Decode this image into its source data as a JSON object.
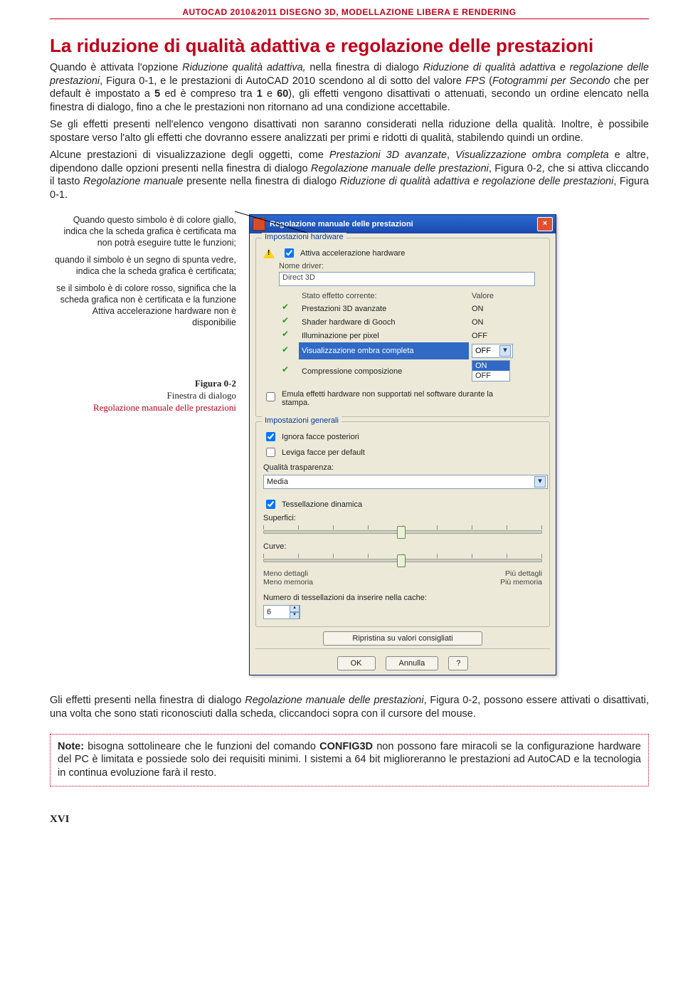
{
  "header": "AUTOCAD 2010&2011 DISEGNO 3D, MODELLAZIONE LIBERA E RENDERING",
  "h1": "La riduzione di qualità adattiva e regolazione delle prestazioni",
  "p1a": "Quando è attivata l'opzione ",
  "p1b": "Riduzione qualità adattiva,",
  "p1c": " nella finestra di dialogo ",
  "p1d": "Riduzione di qualità adattiva e regolazione delle prestazioni",
  "p1e": ", Figura 0-1, e le prestazioni di AutoCAD 2010 scendono al di sotto del valore ",
  "p1f": "FPS",
  "p1g": " (",
  "p1h": "Fotogrammi per Secondo",
  "p1i": " che per default è impostato a ",
  "p1j": "5",
  "p1k": " ed è compreso tra ",
  "p1l": "1",
  "p1m": " e ",
  "p1n": "60",
  "p1o": "), gli effetti vengono disattivati o attenuati, secondo un ordine elencato nella finestra di dialogo, fino a che le prestazioni non ritornano ad una condizione accettabile.",
  "p2": "Se gli effetti presenti nell'elenco vengono disattivati non saranno considerati nella riduzione della qualità. Inoltre, è possibile spostare verso l'alto gli effetti che dovranno essere analizzati per primi e ridotti di qualità, stabilendo quindi un ordine.",
  "p3a": "Alcune prestazioni di visualizzazione degli oggetti, come ",
  "p3b": "Prestazioni 3D avanzate",
  "p3c": ", ",
  "p3d": "Visualizzazione ombra completa",
  "p3e": " e altre, dipendono dalle opzioni presenti nella finestra di dialogo ",
  "p3f": "Regolazione manuale delle prestazioni",
  "p3g": ", Figura 0-2, che si attiva cliccando il tasto ",
  "p3h": "Regolazione manuale",
  "p3i": " presente nella finestra di dialogo ",
  "p3j": "Riduzione di qualità adattiva e regolazione delle prestazioni",
  "p3k": ", Figura 0-1.",
  "side1": "Quando questo simbolo è di colore giallo, indica che la scheda grafica è certificata ma non potrà eseguire tutte le funzioni;",
  "side2": "quando il simbolo è un segno di spunta vedre, indica che la scheda grafica è certificata;",
  "side3": "se il simbolo è di colore rosso, significa che la scheda grafica non è certificata e la funzione Attiva accelerazione hardware non è disponibilie",
  "figN": "Figura 0-2",
  "figT1": "Finestra di dialogo",
  "figT2": "Regolazione manuale delle prestazioni",
  "dialog": {
    "title": "Regolazione manuale delle prestazioni",
    "grp1": "Impostazioni hardware",
    "accel": "Attiva accelerazione hardware",
    "driver_lbl": "Nome driver:",
    "driver_val": "Direct 3D",
    "hdr_state": "Stato effetto corrente:",
    "hdr_val": "Valore",
    "rows": [
      {
        "n": "Prestazioni 3D avanzate",
        "v": "ON"
      },
      {
        "n": "Shader hardware di Gooch",
        "v": "ON"
      },
      {
        "n": "Illuminazione per pixel",
        "v": "OFF"
      }
    ],
    "row_dd_n": "Visualizzazione ombra completa",
    "row_dd_v": "OFF",
    "row_last": "Compressione composizione",
    "menu_on": "ON",
    "menu_off": "OFF",
    "emula": "Emula effetti hardware non supportati nel software durante la stampa.",
    "grp2": "Impostazioni generali",
    "ignora": "Ignora facce posteriori",
    "leviga": "Leviga facce per default",
    "qual": "Qualità trasparenza:",
    "qual_v": "Media",
    "tess": "Tessellazione dinamica",
    "surf": "Superfici:",
    "curve": "Curve:",
    "less1": "Meno dettagli",
    "less2": "Meno memoria",
    "more1": "Più dettagli",
    "more2": "Più memoria",
    "cache": "Numero di tessellazioni da inserire nella cache:",
    "cache_v": "6",
    "reset": "Ripristina su valori consigliati",
    "ok": "OK",
    "cancel": "Annulla",
    "help": "?"
  },
  "p4a": "Gli effetti presenti nella finestra di dialogo ",
  "p4b": "Regolazione manuale delle prestazioni",
  "p4c": ", Figura 0-2, possono essere attivati o disattivati, una volta che sono stati riconosciuti dalla scheda, cliccandoci sopra con il cursore del mouse.",
  "noteL": "Note:",
  "noteA": " bisogna sottolineare che le funzioni del comando ",
  "noteB": "CONFIG3D",
  "noteC": " non possono fare miracoli se la configurazione hardware del PC è limitata e possiede solo dei requisiti minimi. I sistemi a 64 bit miglioreranno le prestazioni ad AutoCAD e la tecnologia in continua evoluzione farà il resto.",
  "page": "XVI"
}
